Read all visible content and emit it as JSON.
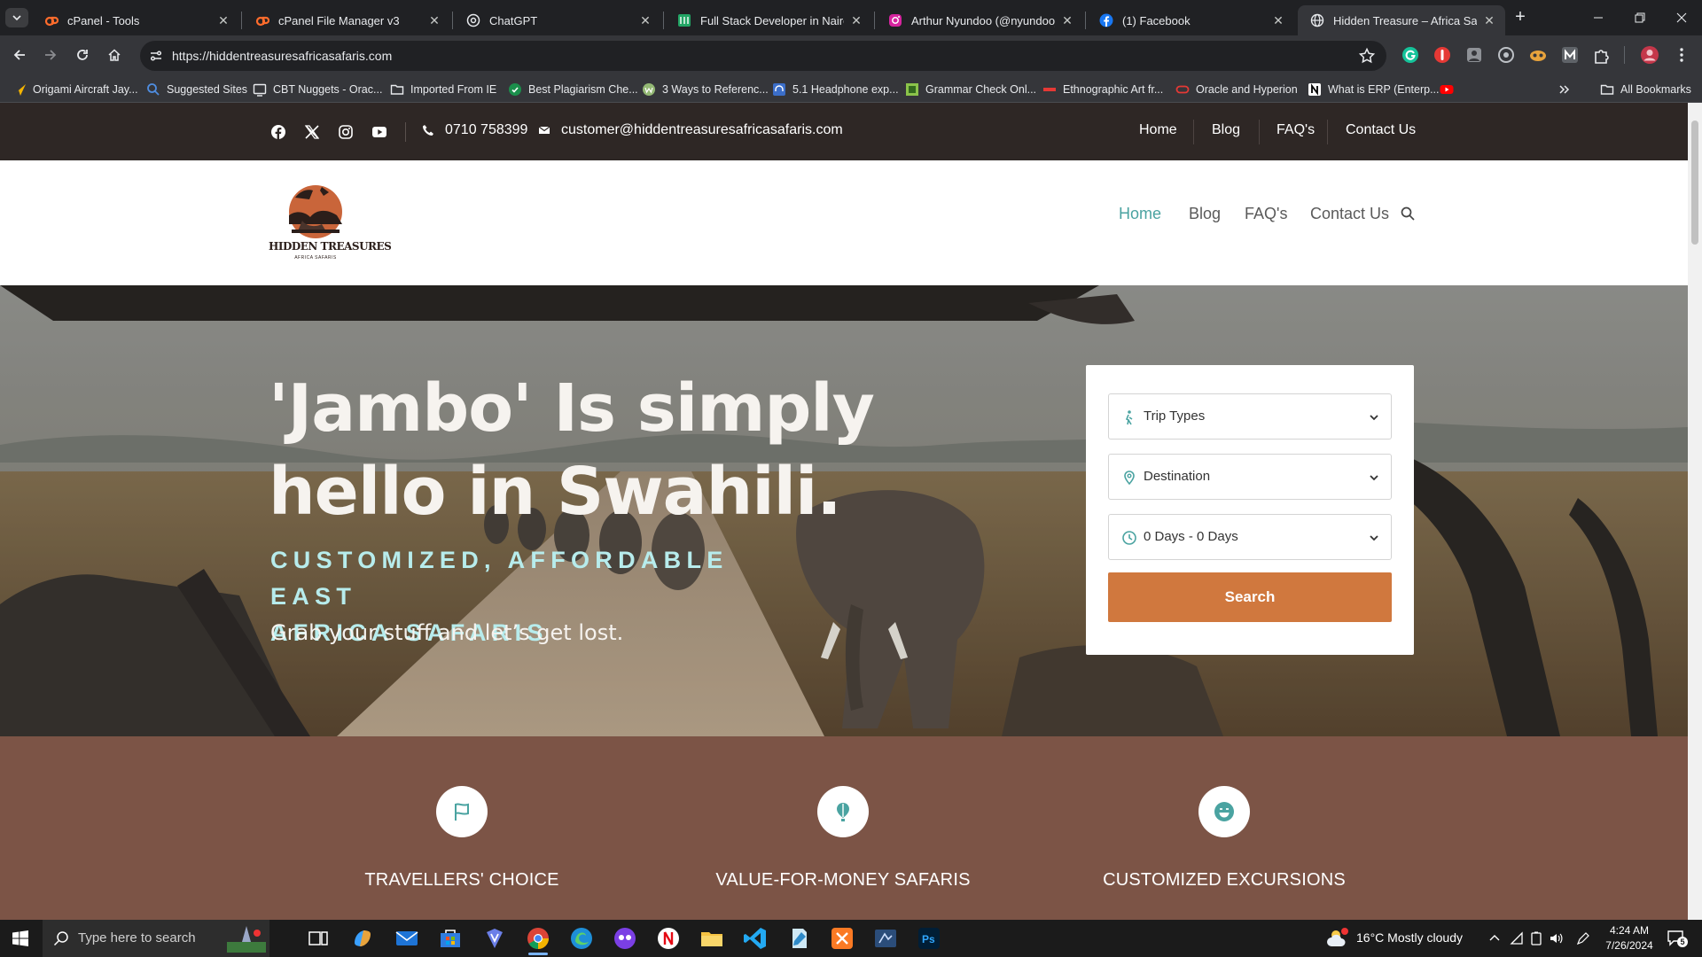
{
  "browser": {
    "tabs": [
      {
        "title": "cPanel - Tools",
        "active": false
      },
      {
        "title": "cPanel File Manager v3",
        "active": false
      },
      {
        "title": "ChatGPT",
        "active": false
      },
      {
        "title": "Full Stack Developer in Nairobi",
        "active": false
      },
      {
        "title": "Arthur Nyundoo (@nyundoo_a",
        "active": false
      },
      {
        "title": "(1) Facebook",
        "active": false
      },
      {
        "title": "Hidden Treasure – Africa Safari",
        "active": true
      }
    ],
    "url": "https://hiddentreasuresafricasafaris.com",
    "bookmarks": [
      "Origami Aircraft Jay...",
      "Suggested Sites",
      "CBT Nuggets - Orac...",
      "Imported From IE",
      "Best Plagiarism Che...",
      "3 Ways to Referenc...",
      "5.1 Headphone exp...",
      "Grammar Check Onl...",
      "Ethnographic Art fr...",
      "Oracle and Hyperion",
      "What is ERP (Enterp..."
    ],
    "all_bookmarks": "All Bookmarks"
  },
  "site": {
    "topbar": {
      "phone": "0710 758399",
      "email": "customer@hiddentreasuresafricasafaris.com",
      "nav": [
        "Home",
        "Blog",
        "FAQ's",
        "Contact Us"
      ]
    },
    "header": {
      "logo_name": "HIDDEN TREASURES",
      "logo_sub": "AFRICA SAFARIS",
      "nav": [
        "Home",
        "Blog",
        "FAQ's",
        "Contact Us"
      ],
      "active_nav": "Home"
    },
    "hero": {
      "title_line1": "'Jambo' Is simply",
      "title_line2": "hello in Swahili.",
      "subtitle_line1": "CUSTOMIZED, AFFORDABLE EAST",
      "subtitle_line2": "AFRICA SAFARIS",
      "tagline": "Grab your stuff and let’s get lost."
    },
    "search": {
      "trip_types": "Trip Types",
      "destination": "Destination",
      "duration": "0 Days - 0 Days",
      "button": "Search"
    },
    "features": [
      {
        "title": "TRAVELLERS' CHOICE",
        "icon": "flag-icon"
      },
      {
        "title": "VALUE-FOR-MONEY SAFARIS",
        "icon": "balloon-icon"
      },
      {
        "title": "CUSTOMIZED EXCURSIONS",
        "icon": "smile-icon"
      }
    ],
    "colors": {
      "accent": "#4aa3a1",
      "button": "#d0783e",
      "features_bg": "#7c5446",
      "topbar_bg": "#2e2725"
    }
  },
  "taskbar": {
    "search_placeholder": "Type here to search",
    "weather": "16°C  Mostly cloudy",
    "time": "4:24 AM",
    "date": "7/26/2024",
    "notifications": "5"
  }
}
